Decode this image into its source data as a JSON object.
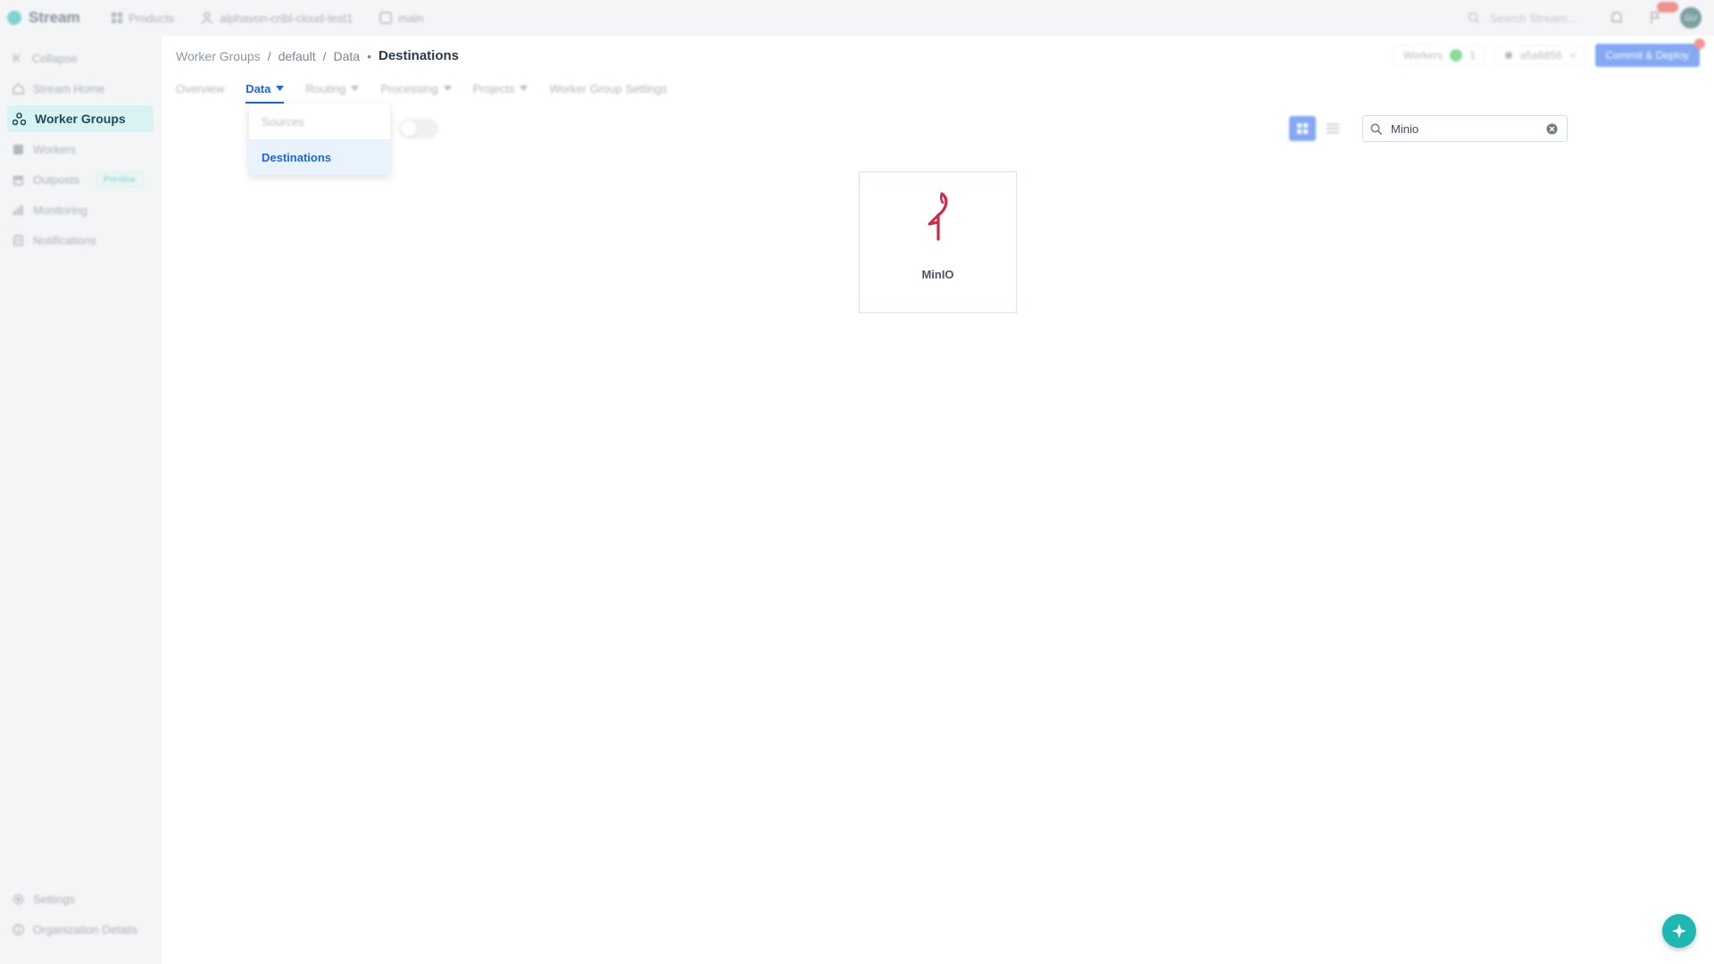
{
  "topbar": {
    "brand": "Stream",
    "products": "Products",
    "org": "alphavon-cribl-cloud-test1",
    "branch": "main",
    "search_placeholder": "Search Stream..."
  },
  "user": {
    "initials": "GU"
  },
  "sidebar": {
    "items": [
      {
        "label": "Collapse",
        "icon": "collapse-icon"
      },
      {
        "label": "Stream Home",
        "icon": "home-icon"
      },
      {
        "label": "Worker Groups",
        "icon": "worker-groups-icon",
        "active": true
      },
      {
        "label": "Workers",
        "icon": "workers-icon"
      },
      {
        "label": "Outposts",
        "icon": "outposts-icon",
        "badge": "Preview"
      },
      {
        "label": "Monitoring",
        "icon": "monitoring-icon"
      },
      {
        "label": "Notifications",
        "icon": "notifications-icon"
      }
    ],
    "bottom": [
      {
        "label": "Settings",
        "icon": "settings-icon"
      },
      {
        "label": "Organization Details",
        "icon": "info-icon"
      }
    ]
  },
  "breadcrumb": {
    "items": [
      "Worker Groups",
      "default",
      "Data"
    ],
    "current": "Destinations"
  },
  "header": {
    "workers_label": "Workers",
    "workers_count": "1",
    "commit": "a5a6856",
    "deploy_label": "Commit & Deploy"
  },
  "tabs": [
    {
      "label": "Overview",
      "has_caret": false
    },
    {
      "label": "Data",
      "has_caret": true,
      "active": true
    },
    {
      "label": "Routing",
      "has_caret": true
    },
    {
      "label": "Processing",
      "has_caret": true
    },
    {
      "label": "Projects",
      "has_caret": true
    },
    {
      "label": "Worker Group Settings",
      "has_caret": false
    }
  ],
  "data_menu": {
    "items": [
      {
        "label": "Sources"
      },
      {
        "label": "Destinations",
        "selected": true
      }
    ]
  },
  "search": {
    "value": "Minio"
  },
  "cards": [
    {
      "label": "MinIO",
      "logo": "minio-logo"
    }
  ],
  "colors": {
    "accent": "#1e63e9",
    "brand": "#1eb8b1",
    "minio_logo": "#c72c48",
    "status_green": "#27c24c"
  }
}
